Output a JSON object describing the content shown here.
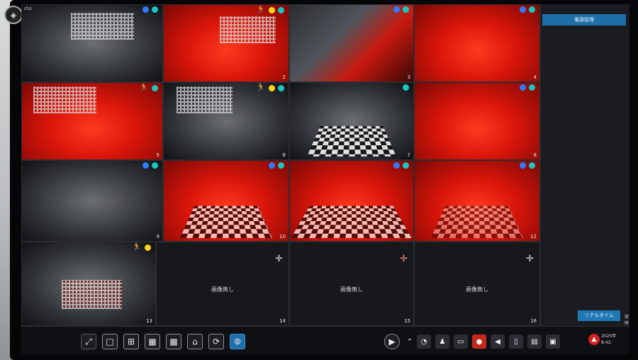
{
  "side_panel": {
    "top_button": "電源管理",
    "realtime_button": "リアルタイム",
    "side_text": "実時"
  },
  "grid": {
    "tiles": [
      {
        "ch": "1",
        "style": "cam-dark",
        "label": "ch1"
      },
      {
        "ch": "2",
        "style": "cam-red"
      },
      {
        "ch": "3",
        "style": "cam-mix"
      },
      {
        "ch": "4",
        "style": "cam-red"
      },
      {
        "ch": "5",
        "style": "cam-red"
      },
      {
        "ch": "6",
        "style": "cam-dark"
      },
      {
        "ch": "7",
        "style": "cam-dark"
      },
      {
        "ch": "8",
        "style": "cam-red"
      },
      {
        "ch": "9",
        "style": "cam-dark"
      },
      {
        "ch": "10",
        "style": "cam-red"
      },
      {
        "ch": "11",
        "style": "cam-red"
      },
      {
        "ch": "12",
        "style": "cam-red"
      },
      {
        "ch": "13",
        "style": "cam-dark"
      },
      {
        "ch": "14",
        "style": "empty",
        "text": "画像無し"
      },
      {
        "ch": "15",
        "style": "empty",
        "text": "画像無し"
      },
      {
        "ch": "16",
        "style": "empty",
        "text": "画像無し"
      }
    ]
  },
  "toolbar": {
    "clock_line1": "2025年",
    "clock_line2": "8:42:",
    "icons": [
      "fullscreen-icon",
      "layout-1-icon",
      "layout-4-icon",
      "layout-9-icon",
      "layout-16-icon",
      "layout-custom-icon",
      "sequence-icon",
      "toggle-icon",
      "play-icon",
      "chevron-up-icon",
      "ptz-icon",
      "person-icon",
      "snapshot-icon",
      "record-icon",
      "speaker-icon",
      "trash-icon",
      "folder-icon",
      "monitor-icon",
      "alarm-icon"
    ]
  },
  "colors": {
    "accent": "#1e6fa8",
    "alarm": "#d62020",
    "motion": "#ffd21a",
    "status_blue": "#2f7bff",
    "status_teal": "#19c7c1"
  }
}
